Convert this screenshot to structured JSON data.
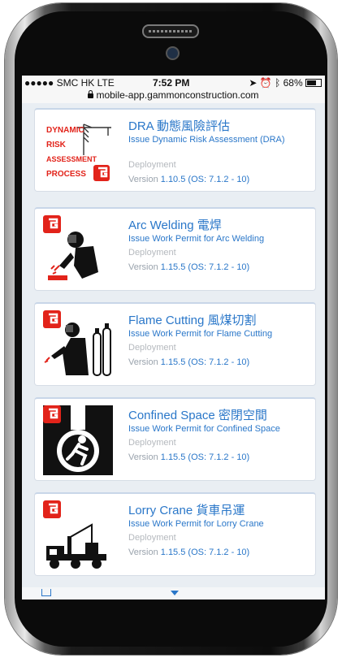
{
  "status_bar": {
    "carrier": "●●●●● SMC HK  LTE",
    "time": "7:52 PM",
    "battery": "68%",
    "url": "mobile-app.gammonconstruction.com"
  },
  "apps": [
    {
      "title": "DRA 動態風險評估",
      "subtitle": "Issue Dynamic Risk Assessment (DRA)",
      "status": "Deployment",
      "version_label": "Version",
      "version": "1.10.5 (OS: 7.1.2 - 10)",
      "icon": "dra-logo-icon"
    },
    {
      "title": "Arc Welding 電焊",
      "subtitle": "Issue Work Permit for Arc Welding",
      "status": "Deployment",
      "version_label": "Version",
      "version": "1.15.5 (OS: 7.1.2 - 10)",
      "icon": "arc-welding-icon"
    },
    {
      "title": "Flame Cutting 風煤切割",
      "subtitle": "Issue Work Permit for Flame Cutting",
      "status": "Deployment",
      "version_label": "Version",
      "version": "1.15.5 (OS: 7.1.2 - 10)",
      "icon": "flame-cutting-icon"
    },
    {
      "title": "Confined Space 密閉空間",
      "subtitle": "Issue Work Permit for Confined Space",
      "status": "Deployment",
      "version_label": "Version",
      "version": "1.15.5 (OS: 7.1.2 - 10)",
      "icon": "confined-space-icon"
    },
    {
      "title": "Lorry Crane 貨車吊運",
      "subtitle": "Issue Work Permit for Lorry Crane",
      "status": "Deployment",
      "version_label": "Version",
      "version": "1.15.5 (OS: 7.1.2 - 10)",
      "icon": "lorry-crane-icon"
    }
  ],
  "dra_logo": {
    "line1": "DYNAMIC",
    "line2": "RISK",
    "line3": "ASSESSMENT",
    "line4": "PROCESS"
  },
  "colors": {
    "link": "#2a77c9",
    "brand_red": "#e2231a",
    "muted": "#b5b9be"
  }
}
